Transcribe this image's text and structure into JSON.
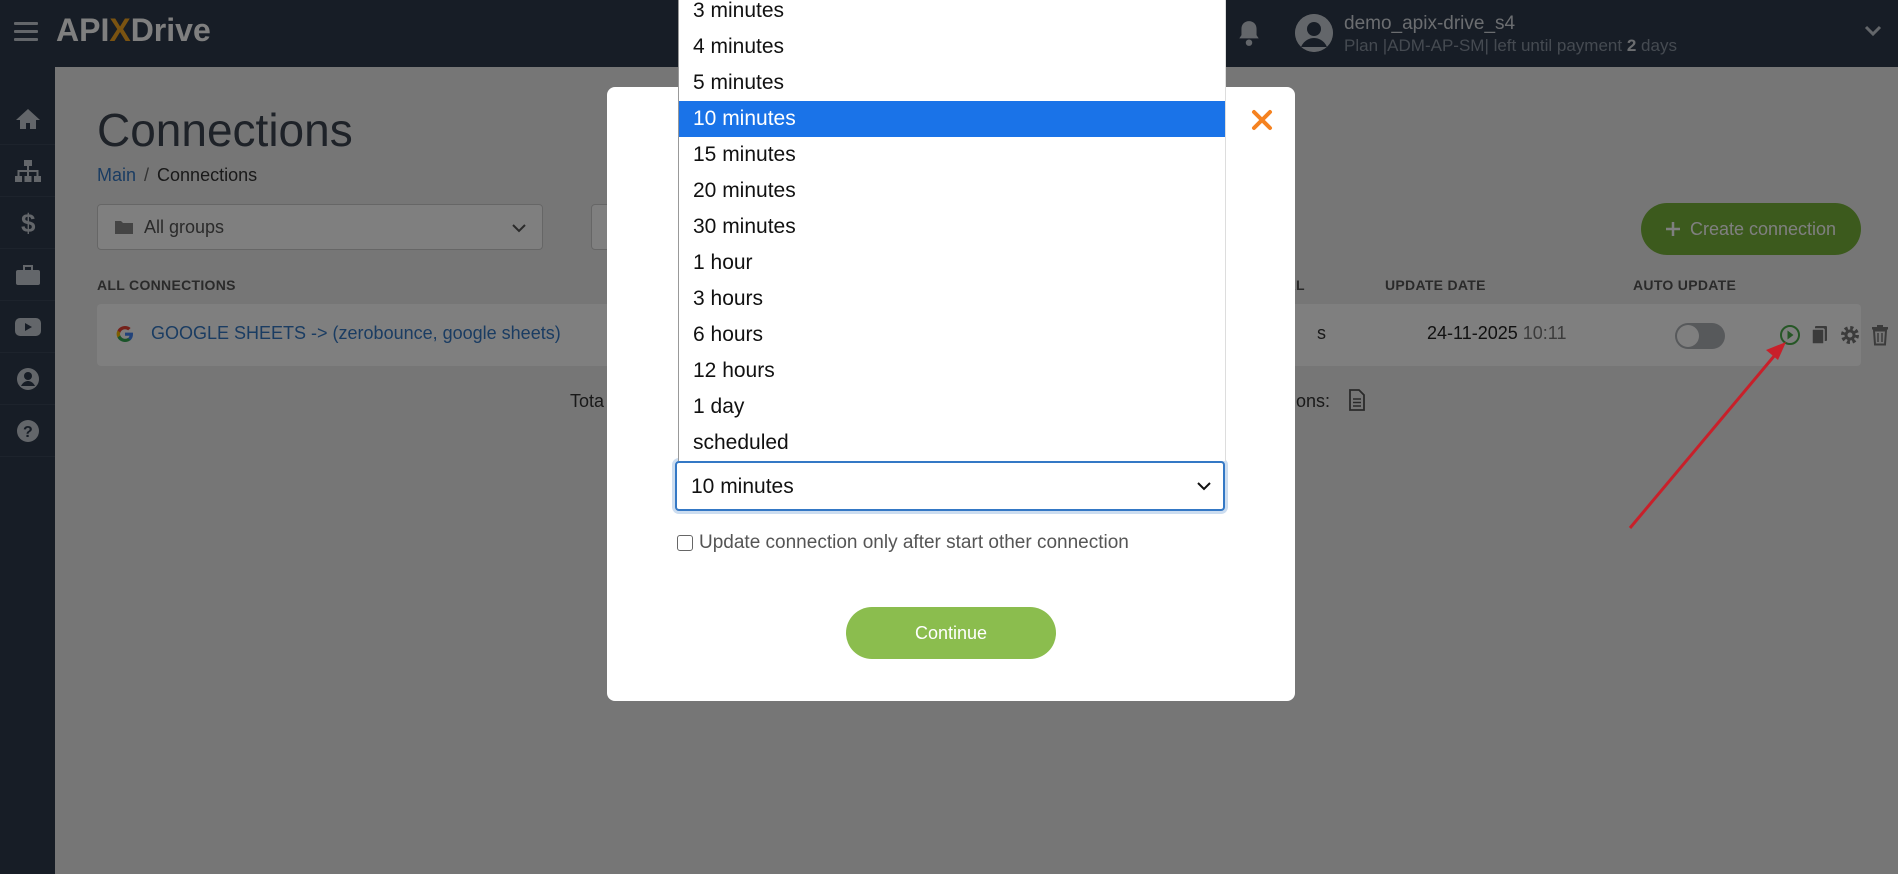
{
  "header": {
    "logo_prefix": "API",
    "logo_x": "X",
    "logo_suffix": "Drive",
    "username": "demo_apix-drive_s4",
    "plan_text": "Plan |ADM-AP-SM| left until payment",
    "plan_days": "2",
    "plan_days_suffix": "days"
  },
  "sidebar": {
    "items": [
      "home-icon",
      "sitemap-icon",
      "dollar-icon",
      "briefcase-icon",
      "youtube-icon",
      "user-icon",
      "help-icon"
    ]
  },
  "page": {
    "title": "Connections",
    "breadcrumb_main": "Main",
    "breadcrumb_sep": "/",
    "breadcrumb_current": "Connections",
    "group_filter": "All groups",
    "create_button": "Create connection"
  },
  "table": {
    "headers": {
      "all_connections": "ALL CONNECTIONS",
      "interval": "VAL",
      "update_date": "UPDATE DATE",
      "auto_update": "AUTO UPDATE"
    },
    "rows": [
      {
        "name": "GOOGLE SHEETS -> (zerobounce, google sheets)",
        "interval_fragment": "s",
        "date": "24-11-2025",
        "time": "10:11",
        "auto_update": false
      }
    ],
    "total_left": "Tota",
    "total_right": "tions:"
  },
  "modal": {
    "options": [
      "3 minutes",
      "4 minutes",
      "5 minutes",
      "10 minutes",
      "15 minutes",
      "20 minutes",
      "30 minutes",
      "1 hour",
      "3 hours",
      "6 hours",
      "12 hours",
      "1 day",
      "scheduled"
    ],
    "selected_index": 3,
    "selected_value": "10 minutes",
    "checkbox_label": "Update connection only after start other connection",
    "continue_label": "Continue"
  },
  "colors": {
    "topbar": "#2e3b4c",
    "accent_green": "#78b53b",
    "link_blue": "#3478c5",
    "close_orange": "#f58220",
    "option_selected": "#1a73e8",
    "arrow": "#c8202a"
  }
}
